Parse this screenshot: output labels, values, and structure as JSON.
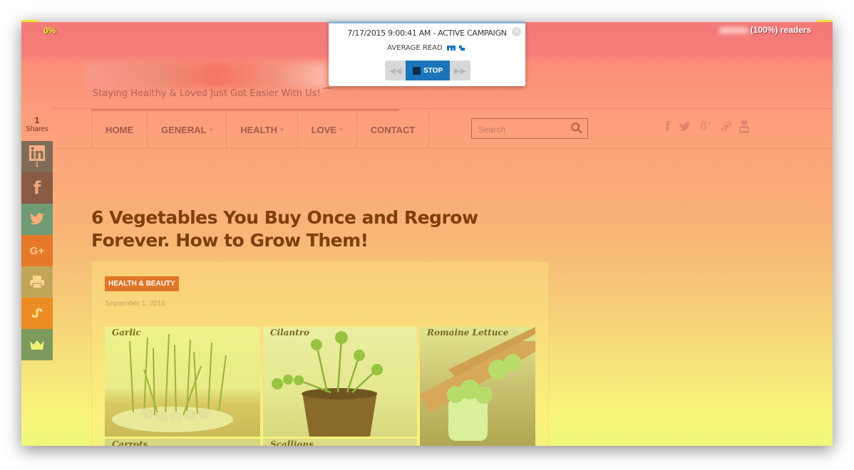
{
  "reader_bar": {
    "percent_label": "0%",
    "readers_label": "(100%) readers"
  },
  "campaign_popup": {
    "timestamp": "7/17/2015 9:00:41 AM - ACTIVE CAMPAIGN",
    "subtitle": "AVERAGE READ",
    "stop_label": "STOP",
    "close_icon": "close-icon",
    "accent_color": "#1b75bb"
  },
  "site": {
    "tagline": "Staying Healthy & Loved Just Got Easier With Us!"
  },
  "nav": {
    "items": [
      {
        "label": "HOME",
        "has_caret": false
      },
      {
        "label": "GENERAL",
        "has_caret": true
      },
      {
        "label": "HEALTH",
        "has_caret": true
      },
      {
        "label": "LOVE",
        "has_caret": true
      },
      {
        "label": "CONTACT",
        "has_caret": false
      }
    ],
    "caret": "˅"
  },
  "search": {
    "placeholder": "Search"
  },
  "header_social": [
    "facebook-icon",
    "twitter-icon",
    "google-plus-icon",
    "pinterest-icon",
    "youtube-icon"
  ],
  "share_bar": {
    "count": "1",
    "count_label": "Shares",
    "buttons": [
      {
        "name": "linkedin",
        "count": "1",
        "color": "#7f6c58"
      },
      {
        "name": "facebook",
        "count": "",
        "color": "#8a5a44"
      },
      {
        "name": "twitter",
        "count": "",
        "color": "#6f9a74"
      },
      {
        "name": "google-plus",
        "count": "",
        "color": "#e67a2a"
      },
      {
        "name": "print",
        "count": "",
        "color": "#c3a55a"
      },
      {
        "name": "stumbleupon",
        "count": "",
        "color": "#ec8c22"
      },
      {
        "name": "crown",
        "count": "",
        "color": "#7c9a5c"
      }
    ]
  },
  "article": {
    "title": "6 Vegetables You Buy Once and Regrow Forever. How to Grow Them!",
    "category": "HEALTH & BEAUTY",
    "date": "September 1, 2016",
    "photo_captions": [
      "Garlic",
      "Cilantro",
      "Romaine Lettuce",
      "Carrots",
      "Scallions"
    ]
  }
}
